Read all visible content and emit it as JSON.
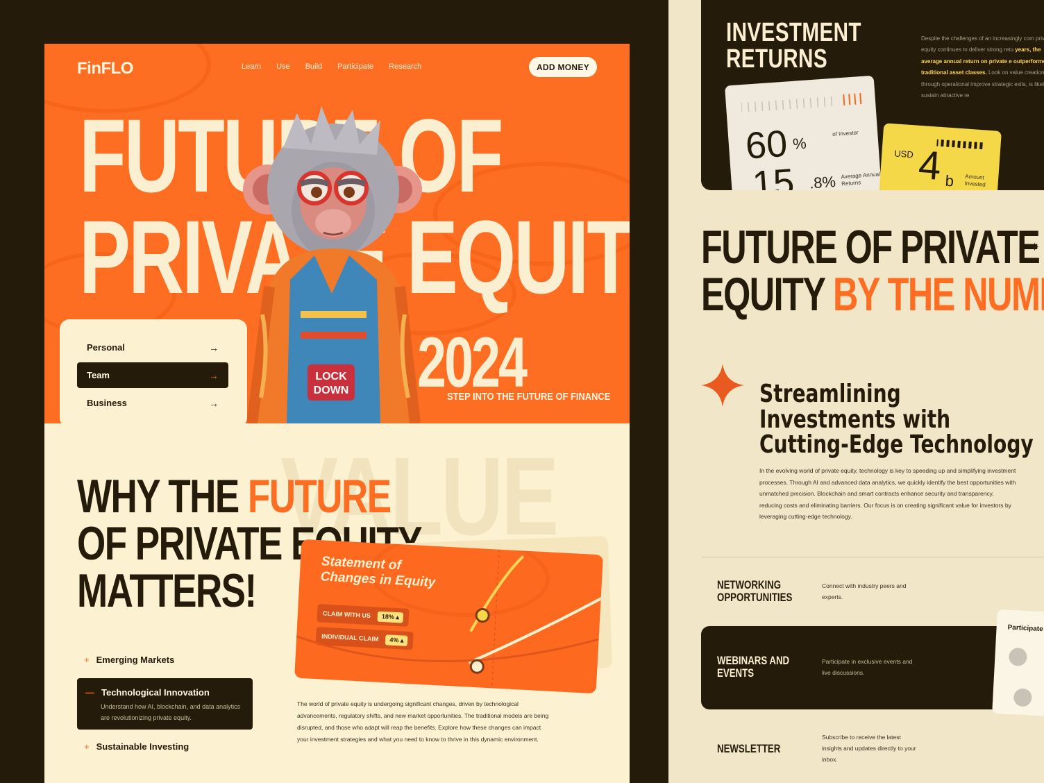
{
  "left": {
    "logo": "FinFLO",
    "nav": [
      "Learn",
      "Use",
      "Build",
      "Participate",
      "Research"
    ],
    "add_money": "ADD MONEY",
    "hero_line1": "FUTURE OF",
    "hero_line2": "PRIVATE EQUITY",
    "hero_year": "2024",
    "tagline": "STEP INTO THE FUTURE OF FINANCE",
    "tabs": [
      {
        "label": "Personal",
        "active": false
      },
      {
        "label": "Team",
        "active": true
      },
      {
        "label": "Business",
        "active": false
      }
    ],
    "watermark": "VALUE",
    "why_line1_a": "WHY THE ",
    "why_line1_b": "FUTURE",
    "why_line2": "OF PRIVATE EQUITY",
    "why_line3": "MATTERS!",
    "statement": {
      "title_line1": "Statement of",
      "title_line2": "Changes in Equity",
      "rows": [
        {
          "label": "CLAIM WITH US",
          "value": "18% ▴"
        },
        {
          "label": "INDIVIDUAL CLAIM",
          "value": "4% ▴"
        }
      ]
    },
    "accordion": [
      {
        "label": "Emerging Markets",
        "open": false
      },
      {
        "label": "Technological Innovation",
        "open": true,
        "description": "Understand how AI, blockchain, and data analytics are revolutionizing private equity."
      },
      {
        "label": "Sustainable Investing",
        "open": false
      }
    ],
    "body_text": "The world of private equity is undergoing significant changes, driven by technological advancements, regulatory shifts, and new market opportunities. The traditional models are being disrupted, and those who adapt will reap the benefits. Explore how these changes can impact your investment strategies and what you need to know to thrive in this dynamic environment.",
    "mascot_badge": "LOCK DOWN"
  },
  "right": {
    "inv_title_1": "INVESTMENT",
    "inv_title_2": "RETURNS",
    "inv_text_a": "Despite the challenges of an increasingly com private equity continues to deliver strong retu",
    "inv_text_b": "years, the average annual return on private e outperformed traditional asset classes.",
    "inv_text_c": " Look on value creation through operational improve strategic exits, is likely to sustain attractive re",
    "stat1_value": "60",
    "stat1_unit": "%",
    "stat1_label": "of Investor",
    "stat2_value": "15",
    "stat2_unit": ".8%",
    "stat2_label": "Average Annual Returns",
    "stat3_currency": "USD",
    "stat3_value": "4",
    "stat3_unit": "b",
    "stat3_label": "Amount Invested",
    "fpe_line1": "FUTURE OF PRIVATE",
    "fpe_line2_a": "EQUITY ",
    "fpe_line2_b": "BY THE NUMB",
    "stream_title_1": "Streamlining",
    "stream_title_2": "Investments with",
    "stream_title_3": "Cutting-Edge Technology",
    "stream_text": "In the evolving world of private equity, technology is key to speeding up and simplifying investment processes. Through AI and advanced data analytics, we quickly identify the best opportunities with unmatched precision. Blockchain and smart contracts enhance security and transparency, reducing costs and eliminating barriers. Our focus is on creating significant value for investors by leveraging cutting-edge technology.",
    "features": [
      {
        "title_1": "NETWORKING",
        "title_2": "OPPORTUNITIES",
        "desc": "Connect with industry peers and experts."
      },
      {
        "title_1": "WEBINARS AND",
        "title_2": "EVENTS",
        "desc": "Participate in exclusive events and live discussions."
      },
      {
        "title_1": "NEWSLETTER",
        "title_2": "",
        "desc": "Subscribe to receive the latest insights and updates directly to your inbox."
      }
    ],
    "participate": "Participate In"
  },
  "colors": {
    "accent": "#fd6e22",
    "dark": "#241b0b",
    "cream": "#fcf1d1",
    "yellow": "#f5d847"
  }
}
